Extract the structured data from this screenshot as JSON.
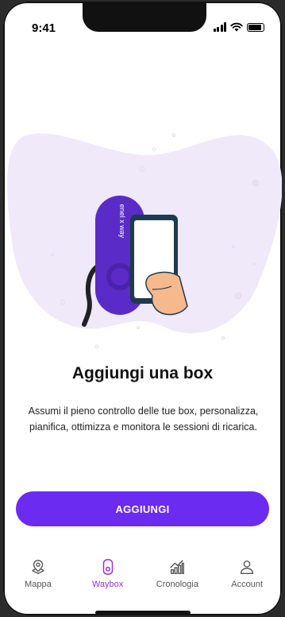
{
  "status_bar": {
    "time": "9:41"
  },
  "onboarding": {
    "title": "Aggiungi una box",
    "description": "Assumi il pieno controllo delle tue box, personalizza, pianifica, ottimizza e monitora le sessioni di ricarica.",
    "cta_label": "AGGIUNGI",
    "brand_text": "enel x way"
  },
  "tab_bar": {
    "items": [
      {
        "label": "Mappa",
        "icon": "map-pin-icon",
        "active": false
      },
      {
        "label": "Waybox",
        "icon": "waybox-icon",
        "active": true
      },
      {
        "label": "Cronologia",
        "icon": "chart-icon",
        "active": false
      },
      {
        "label": "Account",
        "icon": "user-icon",
        "active": false
      }
    ]
  },
  "colors": {
    "accent": "#6b2bf0",
    "active_tab": "#9a2ed8",
    "blob": "#efe9f9",
    "device": "#5b2bc8"
  }
}
